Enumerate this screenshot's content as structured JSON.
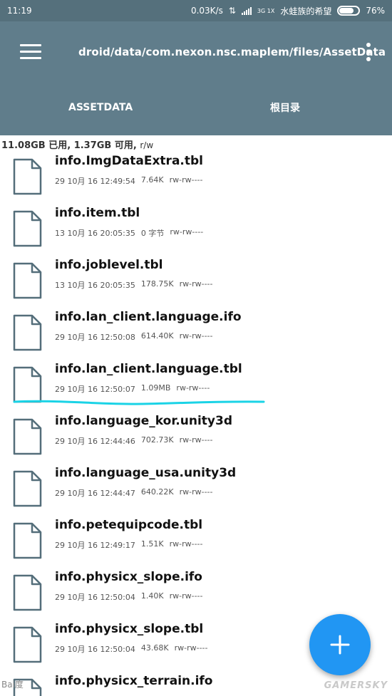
{
  "status_bar": {
    "time": "11:19",
    "speed": "0.03K/s",
    "network": "3G 1X",
    "carrier": "水蛙族的希望",
    "battery": "76%",
    "battery_level": 0.76
  },
  "app_bar": {
    "path": "droid/data/com.nexon.nsc.maplem/files/AssetData"
  },
  "tabs": [
    {
      "label": "ASSETDATA"
    },
    {
      "label": "根目录"
    }
  ],
  "storage": {
    "summary": "11.08GB 已用, 1.37GB 可用,",
    "perm": "r/w"
  },
  "files": [
    {
      "name": "info.ImgDataExtra.tbl",
      "date": "29 10月 16 12:49:54",
      "size": "7.64K",
      "perms": "rw-rw----"
    },
    {
      "name": "info.item.tbl",
      "date": "13 10月 16 20:05:35",
      "size": "0 字节",
      "perms": "rw-rw----"
    },
    {
      "name": "info.joblevel.tbl",
      "date": "13 10月 16 20:05:35",
      "size": "178.75K",
      "perms": "rw-rw----"
    },
    {
      "name": "info.lan_client.language.ifo",
      "date": "29 10月 16 12:50:08",
      "size": "614.40K",
      "perms": "rw-rw----"
    },
    {
      "name": "info.lan_client.language.tbl",
      "date": "29 10月 16 12:50:07",
      "size": "1.09MB",
      "perms": "rw-rw----"
    },
    {
      "name": "info.language_kor.unity3d",
      "date": "29 10月 16 12:44:46",
      "size": "702.73K",
      "perms": "rw-rw----"
    },
    {
      "name": "info.language_usa.unity3d",
      "date": "29 10月 16 12:44:47",
      "size": "640.22K",
      "perms": "rw-rw----"
    },
    {
      "name": "info.petequipcode.tbl",
      "date": "29 10月 16 12:49:17",
      "size": "1.51K",
      "perms": "rw-rw----"
    },
    {
      "name": "info.physicx_slope.ifo",
      "date": "29 10月 16 12:50:04",
      "size": "1.40K",
      "perms": "rw-rw----"
    },
    {
      "name": "info.physicx_slope.tbl",
      "date": "29 10月 16 12:50:04",
      "size": "43.68K",
      "perms": "rw-rw----"
    },
    {
      "name": "info.physicx_terrain.ifo",
      "date": "",
      "size": "",
      "perms": ""
    }
  ],
  "fab": {
    "icon": "plus-icon"
  },
  "watermarks": {
    "left": "Bai度",
    "right": "GAMERSKY"
  },
  "colors": {
    "status_bar": "#55707c",
    "app_bar": "#607d8b",
    "fab": "#2196f3",
    "highlight": "#1ad3e6"
  }
}
